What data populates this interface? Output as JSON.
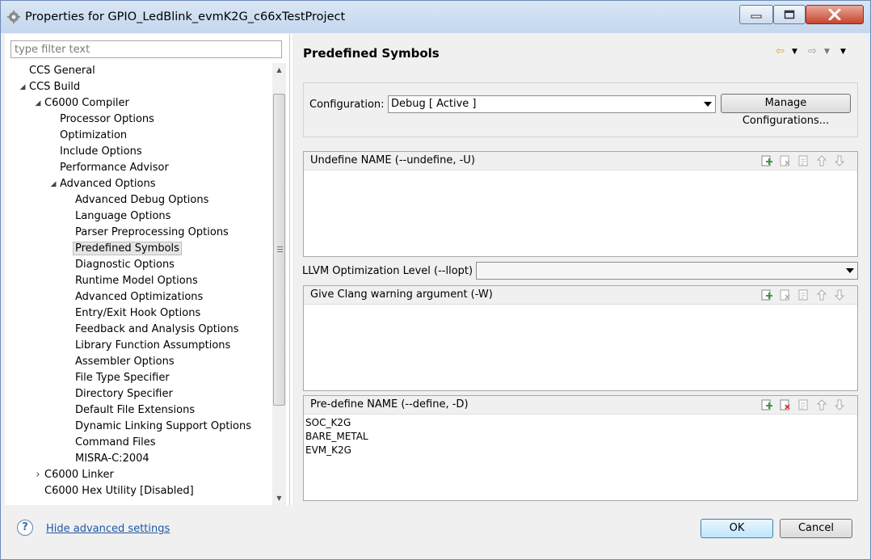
{
  "window": {
    "title": "Properties for GPIO_LedBlink_evmK2G_c66xTestProject"
  },
  "filter": {
    "placeholder": "type filter text"
  },
  "tree": {
    "items": [
      {
        "label": "CCS General",
        "level": 1,
        "expander": "none"
      },
      {
        "label": "CCS Build",
        "level": 1,
        "expander": "expanded"
      },
      {
        "label": "C6000 Compiler",
        "level": 2,
        "expander": "expanded"
      },
      {
        "label": "Processor Options",
        "level": 3,
        "expander": "none"
      },
      {
        "label": "Optimization",
        "level": 3,
        "expander": "none"
      },
      {
        "label": "Include Options",
        "level": 3,
        "expander": "none"
      },
      {
        "label": "Performance Advisor",
        "level": 3,
        "expander": "none"
      },
      {
        "label": "Advanced Options",
        "level": 3,
        "expander": "expanded"
      },
      {
        "label": "Advanced Debug Options",
        "level": 4,
        "expander": "none"
      },
      {
        "label": "Language Options",
        "level": 4,
        "expander": "none"
      },
      {
        "label": "Parser Preprocessing Options",
        "level": 4,
        "expander": "none"
      },
      {
        "label": "Predefined Symbols",
        "level": 4,
        "expander": "none",
        "selected": true
      },
      {
        "label": "Diagnostic Options",
        "level": 4,
        "expander": "none"
      },
      {
        "label": "Runtime Model Options",
        "level": 4,
        "expander": "none"
      },
      {
        "label": "Advanced Optimizations",
        "level": 4,
        "expander": "none"
      },
      {
        "label": "Entry/Exit Hook Options",
        "level": 4,
        "expander": "none"
      },
      {
        "label": "Feedback and Analysis Options",
        "level": 4,
        "expander": "none"
      },
      {
        "label": "Library Function Assumptions",
        "level": 4,
        "expander": "none"
      },
      {
        "label": "Assembler Options",
        "level": 4,
        "expander": "none"
      },
      {
        "label": "File Type Specifier",
        "level": 4,
        "expander": "none"
      },
      {
        "label": "Directory Specifier",
        "level": 4,
        "expander": "none"
      },
      {
        "label": "Default File Extensions",
        "level": 4,
        "expander": "none"
      },
      {
        "label": "Dynamic Linking Support Options",
        "level": 4,
        "expander": "none"
      },
      {
        "label": "Command Files",
        "level": 4,
        "expander": "none"
      },
      {
        "label": "MISRA-C:2004",
        "level": 4,
        "expander": "none"
      },
      {
        "label": "C6000 Linker",
        "level": 2,
        "expander": "collapsed"
      },
      {
        "label": "C6000 Hex Utility  [Disabled]",
        "level": 2,
        "expander": "none"
      }
    ]
  },
  "page": {
    "title": "Predefined Symbols"
  },
  "configuration": {
    "label": "Configuration:",
    "value": "Debug  [ Active ]",
    "manage_label": "Manage Configurations..."
  },
  "undefine": {
    "header": "Undefine NAME (--undefine, -U)",
    "entries": []
  },
  "llvm": {
    "label": "LLVM Optimization Level (--llopt)",
    "value": ""
  },
  "clang": {
    "header": "Give Clang warning argument (-W)",
    "entries": []
  },
  "predefine": {
    "header": "Pre-define NAME (--define, -D)",
    "entries": [
      "SOC_K2G",
      "BARE_METAL",
      "EVM_K2G"
    ]
  },
  "footer": {
    "help_link": "Hide advanced settings",
    "ok_label": "OK",
    "cancel_label": "Cancel"
  },
  "icons": {
    "app": "gear-app-icon",
    "back": "back-arrow-icon",
    "forward": "forward-arrow-icon",
    "view_menu": "view-menu-icon",
    "add": "add-icon",
    "delete": "delete-icon",
    "edit": "edit-icon",
    "move_up": "move-up-icon",
    "move_down": "move-down-icon",
    "help": "help-icon"
  },
  "colors": {
    "accent": "#1f57a6",
    "selection": "#e5e5e5",
    "titlebar": "#c4d7ee"
  }
}
